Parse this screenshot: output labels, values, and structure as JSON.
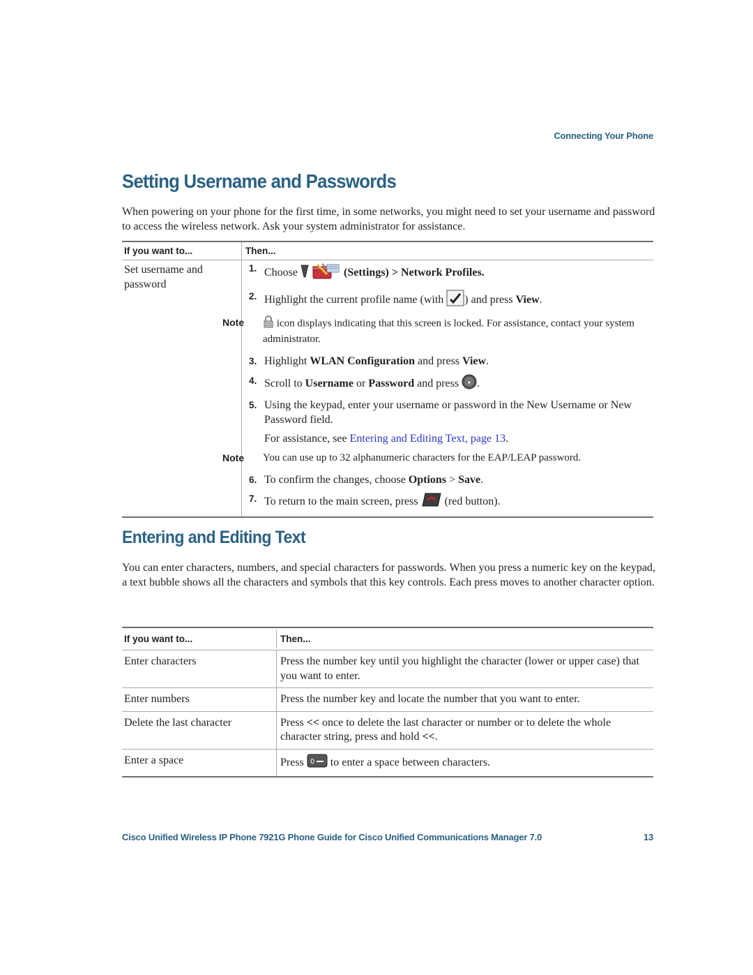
{
  "header": {
    "running_head": "Connecting Your Phone"
  },
  "section1": {
    "title": "Setting Username and Passwords",
    "intro": "When powering on your phone for the first time, in some networks, you might need to set your username and password to access the wireless network. Ask your system administrator for assistance.",
    "table": {
      "col1_header": "If you want to...",
      "col2_header": "Then...",
      "row_task": "Set username and password",
      "steps": {
        "s1": {
          "num": "1.",
          "pre": "Choose",
          "icon_post": "(Settings) > Network Profiles."
        },
        "s2": {
          "num": "2.",
          "pre": "Highlight the current profile name (with",
          "post": ") and press",
          "bold": "View",
          "end": "."
        },
        "note1": {
          "label": "Note",
          "text": "icon displays indicating that this screen is locked. For assistance, contact your system administrator."
        },
        "s3": {
          "num": "3.",
          "pre": "Highlight",
          "bold1": "WLAN Configuration",
          "mid": "and press",
          "bold2": "View",
          "end": "."
        },
        "s4": {
          "num": "4.",
          "pre": "Scroll to",
          "bold1": "Username",
          "mid": "or",
          "bold2": "Password",
          "post": "and press",
          "end": "."
        },
        "s5": {
          "num": "5.",
          "text": "Using the keypad, enter your username or password in the New Username or New Password field.",
          "assist_pre": "For assistance, see",
          "assist_link": "Entering and Editing Text, page 13",
          "assist_end": "."
        },
        "note2": {
          "label": "Note",
          "text": "You can use up to 32 alphanumeric characters for the EAP/LEAP password."
        },
        "s6": {
          "num": "6.",
          "pre": "To confirm the changes, choose",
          "bold1": "Options",
          "mid": ">",
          "bold2": "Save",
          "end": "."
        },
        "s7": {
          "num": "7.",
          "pre": "To return to the main screen, press",
          "post": "(red button)."
        }
      }
    }
  },
  "section2": {
    "title": "Entering and Editing Text",
    "intro": "You can enter characters, numbers, and special characters for passwords. When you press a numeric key on the keypad, a text bubble shows all the characters and symbols that this key controls. Each press moves to another character option.",
    "table": {
      "col1_header": "If you want to...",
      "col2_header": "Then...",
      "rows": [
        {
          "task": "Enter characters",
          "action": "Press the number key until you highlight the character (lower or upper case) that you want to enter."
        },
        {
          "task": "Enter numbers",
          "action": "Press the number key and locate the number that you want to enter."
        },
        {
          "task": "Delete the last character",
          "a1": "Press",
          "b1": "<<",
          "a2": "once to delete the last character or number or to delete the whole character string, press and hold",
          "b2": "<<",
          "a3": "."
        },
        {
          "task": "Enter a space",
          "pre": "Press",
          "post": "to enter a space between characters."
        }
      ]
    }
  },
  "footer": {
    "title": "Cisco Unified Wireless IP Phone 7921G Phone Guide for Cisco Unified Communications Manager 7.0",
    "page_number": "13"
  }
}
